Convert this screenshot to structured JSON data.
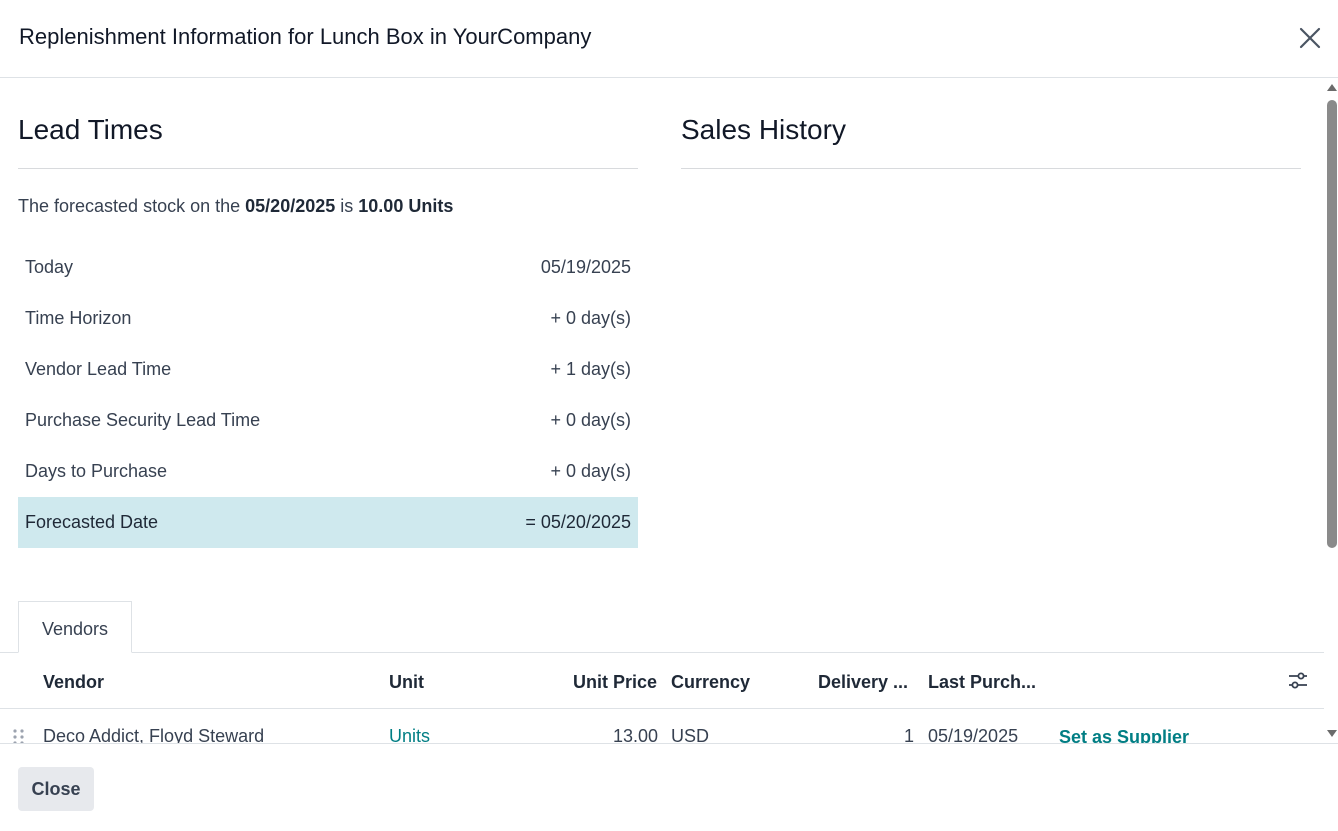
{
  "dialog": {
    "title": "Replenishment Information for Lunch Box in YourCompany",
    "close_icon": "close-icon"
  },
  "lead_times": {
    "title": "Lead Times",
    "forecast_prefix": "The forecasted stock on the",
    "forecast_date": "05/20/2025",
    "forecast_mid": "is",
    "forecast_qty": "10.00 Units",
    "rows": [
      {
        "label": "Today",
        "value": "05/19/2025"
      },
      {
        "label": "Time Horizon",
        "value": "+ 0 day(s)"
      },
      {
        "label": "Vendor Lead Time",
        "value": "+ 1 day(s)"
      },
      {
        "label": "Purchase Security Lead Time",
        "value": "+ 0 day(s)"
      },
      {
        "label": "Days to Purchase",
        "value": "+ 0 day(s)"
      },
      {
        "label": "Forecasted Date",
        "value": "= 05/20/2025"
      }
    ]
  },
  "sales_history": {
    "title": "Sales History"
  },
  "tabs": [
    {
      "label": "Vendors"
    }
  ],
  "vendors_table": {
    "columns": [
      "Vendor",
      "Unit",
      "Unit Price",
      "Currency",
      "Delivery ...",
      "Last Purch..."
    ],
    "rows": [
      {
        "vendor": "Deco Addict, Floyd Steward",
        "unit": "Units",
        "unit_price": "13.00",
        "currency": "USD",
        "delivery": "1",
        "last_purchase": "05/19/2025",
        "action": "Set as Supplier"
      }
    ]
  },
  "footer": {
    "close_label": "Close"
  },
  "colors": {
    "accent": "#017e84",
    "highlight_row": "#cfe9ee",
    "button_bg": "#e7e9ed"
  }
}
